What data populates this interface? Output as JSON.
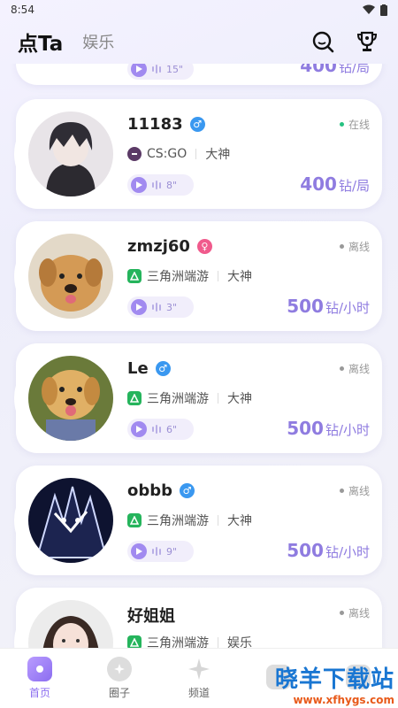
{
  "status_bar": {
    "time": "8:54"
  },
  "header": {
    "title": "点Ta",
    "secondary_tab": "娱乐"
  },
  "partial_top_card": {
    "voice_duration": "15\"",
    "price": "400",
    "unit": "钻/局"
  },
  "cards": [
    {
      "name": "11183",
      "gender": "male",
      "status": "在线",
      "online": true,
      "game": "CS:GO",
      "game_icon": "csgo",
      "rank": "大神",
      "voice_duration": "8\"",
      "price": "400",
      "unit": "钻/局"
    },
    {
      "name": "zmzj60",
      "gender": "female",
      "status": "离线",
      "online": false,
      "game": "三角洲端游",
      "game_icon": "tri",
      "rank": "大神",
      "voice_duration": "3\"",
      "price": "500",
      "unit": "钻/小时"
    },
    {
      "name": "Le",
      "gender": "male",
      "status": "离线",
      "online": false,
      "game": "三角洲端游",
      "game_icon": "tri",
      "rank": "大神",
      "voice_duration": "6\"",
      "price": "500",
      "unit": "钻/小时"
    },
    {
      "name": "obbb",
      "gender": "male",
      "status": "离线",
      "online": false,
      "game": "三角洲端游",
      "game_icon": "tri",
      "rank": "大神",
      "voice_duration": "9\"",
      "price": "500",
      "unit": "钻/小时"
    },
    {
      "name": "好姐姐",
      "gender": "none",
      "status": "离线",
      "online": false,
      "game": "三角洲端游",
      "game_icon": "tri",
      "rank": "娱乐",
      "voice_duration": "",
      "price": "",
      "unit": ""
    }
  ],
  "tabbar": [
    {
      "label": "首页",
      "active": true
    },
    {
      "label": "圈子",
      "active": false
    },
    {
      "label": "频道",
      "active": false
    },
    {
      "label": "",
      "active": false
    },
    {
      "label": "",
      "active": false
    }
  ],
  "watermark": {
    "title": "晓羊下载站",
    "url": "www.xfhygs.com"
  },
  "colors": {
    "accent": "#8f7ce0",
    "online": "#26c281",
    "male": "#3a98f0",
    "female": "#f05a8c"
  }
}
